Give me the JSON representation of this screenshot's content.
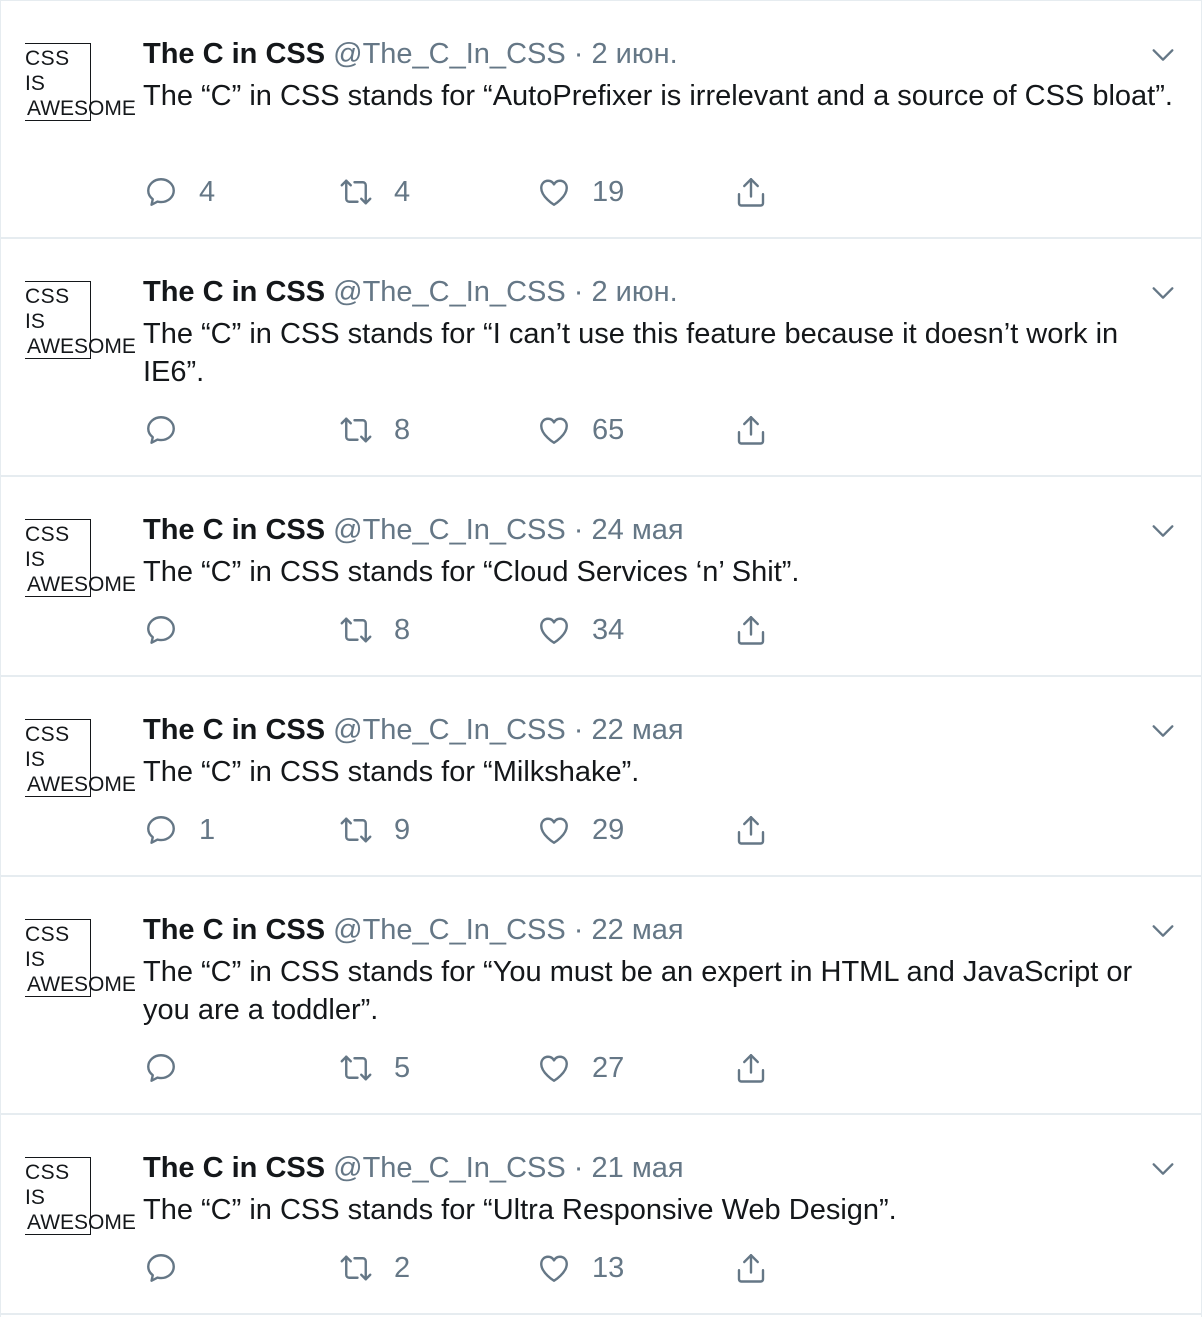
{
  "tweets": [
    {
      "avatar": {
        "line1": "CSS",
        "line2": "IS",
        "line3": "AWESOME"
      },
      "name": "The C in CSS",
      "handle": "@The_C_In_CSS",
      "separator": "·",
      "date": "2 июн.",
      "text": "The “C” in CSS stands for “AutoPrefixer is irrelevant and a source of CSS bloat”.",
      "replies": "4",
      "retweets": "4",
      "likes": "19"
    },
    {
      "avatar": {
        "line1": "CSS",
        "line2": "IS",
        "line3": "AWESOME"
      },
      "name": "The C in CSS",
      "handle": "@The_C_In_CSS",
      "separator": "·",
      "date": "2 июн.",
      "text": "The “C” in CSS stands for “I can’t use this feature because it doesn’t work in IE6”.",
      "replies": "",
      "retweets": "8",
      "likes": "65"
    },
    {
      "avatar": {
        "line1": "CSS",
        "line2": "IS",
        "line3": "AWESOME"
      },
      "name": "The C in CSS",
      "handle": "@The_C_In_CSS",
      "separator": "·",
      "date": "24 мая",
      "text": "The “C” in CSS stands for “Cloud Services ‘n’ Shit”.",
      "replies": "",
      "retweets": "8",
      "likes": "34"
    },
    {
      "avatar": {
        "line1": "CSS",
        "line2": "IS",
        "line3": "AWESOME"
      },
      "name": "The C in CSS",
      "handle": "@The_C_In_CSS",
      "separator": "·",
      "date": "22 мая",
      "text": "The “C” in CSS stands for “Milkshake”.",
      "replies": "1",
      "retweets": "9",
      "likes": "29"
    },
    {
      "avatar": {
        "line1": "CSS",
        "line2": "IS",
        "line3": "AWESOME"
      },
      "name": "The C in CSS",
      "handle": "@The_C_In_CSS",
      "separator": "·",
      "date": "22 мая",
      "text": "The “C” in CSS stands for “You must be an expert in HTML and JavaScript or you are a toddler”.",
      "replies": "",
      "retweets": "5",
      "likes": "27"
    },
    {
      "avatar": {
        "line1": "CSS",
        "line2": "IS",
        "line3": "AWESOME"
      },
      "name": "The C in CSS",
      "handle": "@The_C_In_CSS",
      "separator": "·",
      "date": "21 мая",
      "text": "The “C” in CSS stands for “Ultra Responsive Web Design”.",
      "replies": "",
      "retweets": "2",
      "likes": "13"
    }
  ],
  "icons": {
    "reply": "reply-icon",
    "retweet": "retweet-icon",
    "like": "heart-icon",
    "share": "share-icon",
    "menu": "chevron-down-icon"
  },
  "colors": {
    "text": "#14171a",
    "secondary": "#657786",
    "divider": "#e6ecf0"
  }
}
